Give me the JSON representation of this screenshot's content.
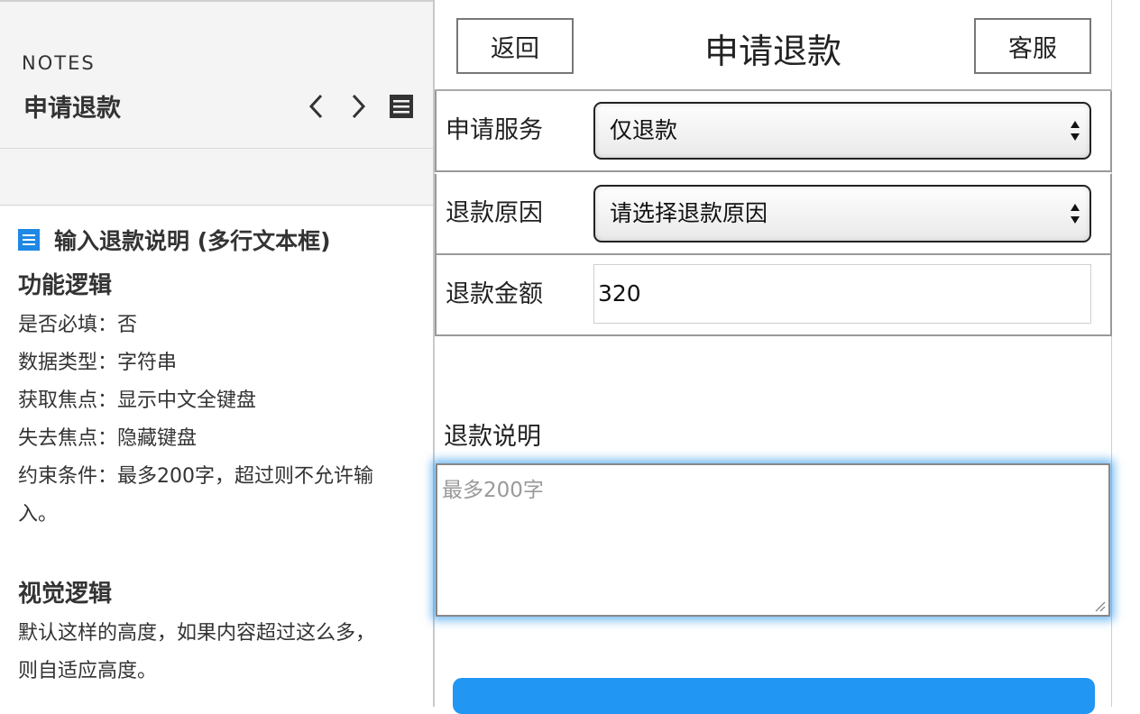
{
  "notes": {
    "label": "NOTES",
    "title": "申请退款",
    "section_title": "输入退款说明 (多行文本框)",
    "function_heading": "功能逻辑",
    "function_lines": [
      "是否必填：否",
      "数据类型：字符串",
      "获取焦点：显示中文全键盘",
      "失去焦点：隐藏键盘",
      "约束条件：最多200字，超过则不允许输",
      "入。"
    ],
    "visual_heading": "视觉逻辑",
    "visual_lines": [
      "默认这样的高度，如果内容超过这么多，",
      "则自适应高度。"
    ]
  },
  "header": {
    "back_label": "返回",
    "title": "申请退款",
    "service_label": "客服"
  },
  "form": {
    "service_type": {
      "label": "申请服务",
      "value": "仅退款"
    },
    "reason": {
      "label": "退款原因",
      "value": "请选择退款原因"
    },
    "amount": {
      "label": "退款金额",
      "value": "320"
    },
    "description": {
      "label": "退款说明",
      "placeholder": "最多200字"
    }
  },
  "colors": {
    "accent": "#2196f3",
    "focus_glow": "#40a0f0"
  },
  "icons": {
    "prev": "chevron-left-icon",
    "next": "chevron-right-icon",
    "menu": "menu-icon",
    "section": "list-icon",
    "select_arrows": "select-arrows-icon"
  }
}
